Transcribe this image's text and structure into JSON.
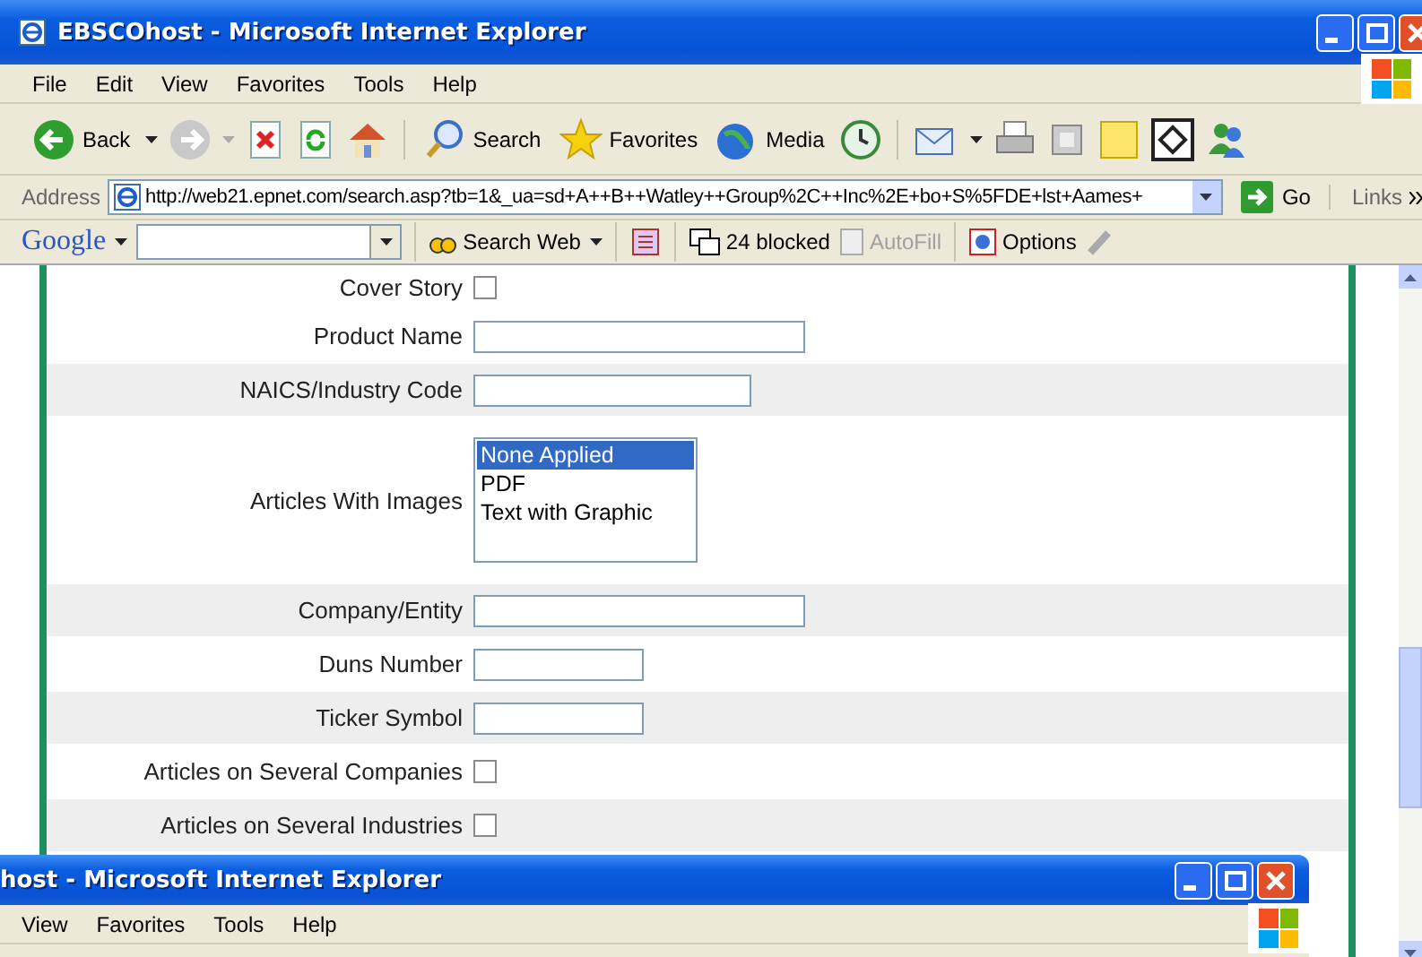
{
  "window": {
    "title": "EBSCOhost - Microsoft Internet Explorer"
  },
  "menu": [
    "File",
    "Edit",
    "View",
    "Favorites",
    "Tools",
    "Help"
  ],
  "toolbar": {
    "back": "Back",
    "search": "Search",
    "favorites": "Favorites",
    "media": "Media"
  },
  "address_bar": {
    "label": "Address",
    "url": "http://web21.epnet.com/search.asp?tb=1&_ua=sd+A++B++Watley++Group%2C++Inc%2E+bo+S%5FDE+lst+Aames+",
    "go": "Go",
    "links": "Links"
  },
  "google_bar": {
    "logo": "Google",
    "search_web": "Search Web",
    "blocked": "24 blocked",
    "autofill": "AutoFill",
    "options": "Options"
  },
  "form_rows": [
    {
      "label": "Cover Story",
      "kind": "checkbox",
      "checked": false
    },
    {
      "label": "Product Name",
      "kind": "text"
    },
    {
      "label": "NAICS/Industry Code",
      "kind": "text"
    },
    {
      "label": "Articles With Images",
      "kind": "listbox",
      "options": [
        {
          "label": "None Applied",
          "selected": true
        },
        {
          "label": "PDF",
          "selected": false
        },
        {
          "label": "Text with Graphic",
          "selected": false
        }
      ]
    },
    {
      "label": "Company/Entity",
      "kind": "text"
    },
    {
      "label": "Duns Number",
      "kind": "text"
    },
    {
      "label": "Ticker Symbol",
      "kind": "text"
    },
    {
      "label": "Articles on Several Companies",
      "kind": "checkbox",
      "checked": false
    },
    {
      "label": "Articles on Several Industries",
      "kind": "checkbox",
      "checked": false
    }
  ],
  "second_window": {
    "title": "host - Microsoft Internet Explorer",
    "menu": [
      "View",
      "Favorites",
      "Tools",
      "Help"
    ]
  }
}
